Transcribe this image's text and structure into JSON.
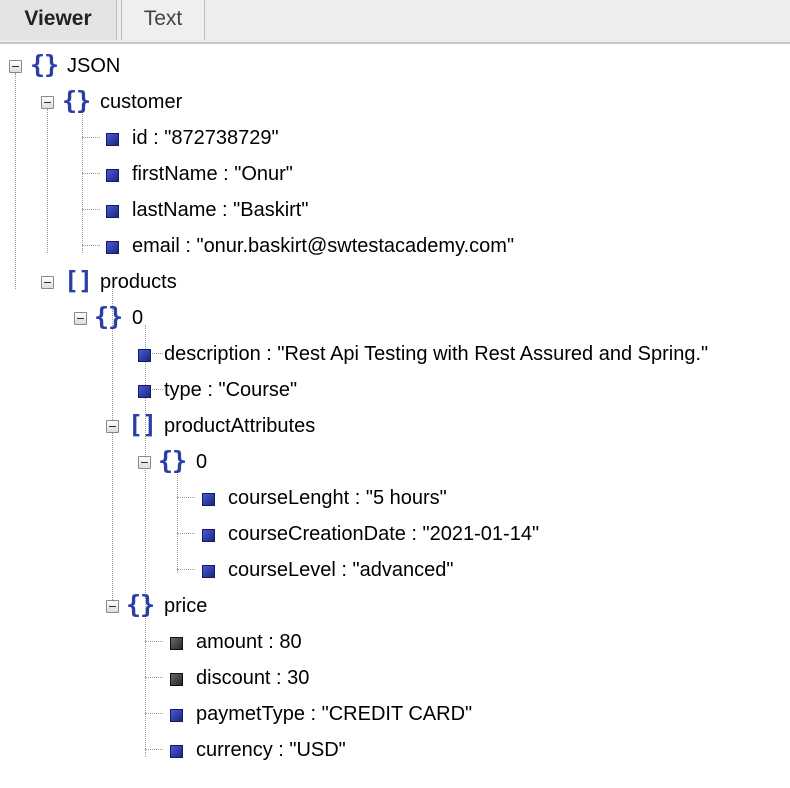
{
  "tabs": {
    "viewer": "Viewer",
    "text": "Text"
  },
  "tree": {
    "root": "JSON",
    "customer": "customer",
    "id": "id : \"872738729\"",
    "firstName": "firstName : \"Onur\"",
    "lastName": "lastName : \"Baskirt\"",
    "email": "email : \"onur.baskirt@swtestacademy.com\"",
    "products": "products",
    "product0": "0",
    "description": "description : \"Rest Api Testing with Rest Assured and Spring.\"",
    "type": "type : \"Course\"",
    "productAttributes": "productAttributes",
    "attr0": "0",
    "courseLenght": "courseLenght : \"5 hours\"",
    "courseCreationDate": "courseCreationDate : \"2021-01-14\"",
    "courseLevel": "courseLevel : \"advanced\"",
    "price": "price",
    "amount": "amount : 80",
    "discount": "discount : 30",
    "paymetType": "paymetType : \"CREDIT CARD\"",
    "currency": "currency : \"USD\""
  },
  "icons": {
    "object": "curly-braces-icon",
    "array": "square-brackets-icon",
    "string_leaf": "blue-square-icon",
    "number_leaf": "gray-square-icon"
  }
}
